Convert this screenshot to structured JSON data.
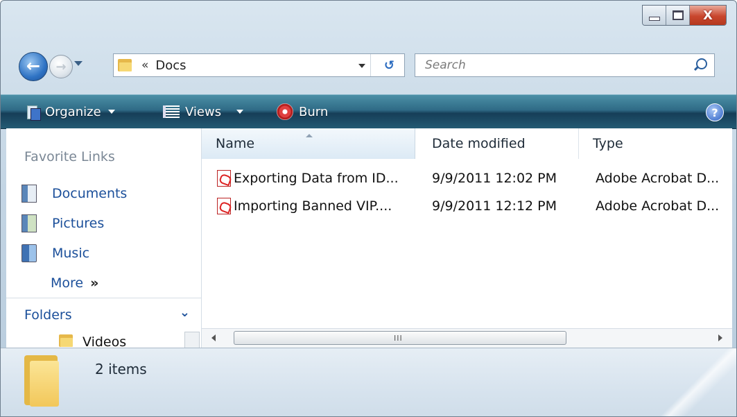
{
  "window": {
    "caption": {
      "minimize": "minimize",
      "maximize": "maximize",
      "close": "X"
    }
  },
  "nav": {
    "breadcrumb_prefix": "«",
    "breadcrumb": "Docs",
    "search_placeholder": "Search"
  },
  "toolbar": {
    "organize": "Organize",
    "views": "Views",
    "burn": "Burn",
    "help": "?"
  },
  "sidebar": {
    "favorites_title": "Favorite Links",
    "favorites": [
      {
        "label": "Documents",
        "icon": "documents-icon"
      },
      {
        "label": "Pictures",
        "icon": "pictures-icon"
      },
      {
        "label": "Music",
        "icon": "music-icon"
      }
    ],
    "more": "More",
    "more_arrow": "»",
    "folders_label": "Folders",
    "folders_chevron": "⌄",
    "tree": [
      {
        "label": "Videos"
      }
    ]
  },
  "files": {
    "columns": [
      "Name",
      "Date modified",
      "Type"
    ],
    "rows": [
      {
        "name": "Exporting Data from ID...",
        "date": "9/9/2011 12:02 PM",
        "type": "Adobe Acrobat D..."
      },
      {
        "name": "Importing Banned VIP....",
        "date": "9/9/2011 12:12 PM",
        "type": "Adobe Acrobat D..."
      }
    ],
    "scroll_grip": "III"
  },
  "details": {
    "count": "2 items"
  },
  "colors": {
    "toolbar": "#235a73",
    "link": "#1b4f9a",
    "close": "#c9462d"
  }
}
